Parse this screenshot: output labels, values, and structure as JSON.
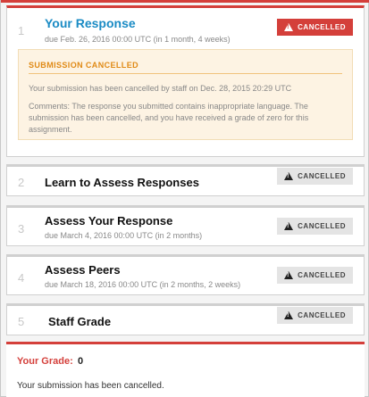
{
  "steps": [
    {
      "number": "1",
      "title": "Your Response",
      "due": "due Feb. 26, 2016 00:00 UTC (in 1 month, 4 weeks)",
      "status": "CANCELLED"
    },
    {
      "number": "2",
      "title": "Learn to Assess Responses",
      "due": "",
      "status": "CANCELLED"
    },
    {
      "number": "3",
      "title": "Assess Your Response",
      "due": "due March 4, 2016 00:00 UTC (in 2 months)",
      "status": "CANCELLED"
    },
    {
      "number": "4",
      "title": "Assess Peers",
      "due": "due March 18, 2016 00:00 UTC (in 2 months, 2 weeks)",
      "status": "CANCELLED"
    },
    {
      "number": "5",
      "title": "Staff Grade",
      "due": "",
      "status": "CANCELLED"
    }
  ],
  "notice": {
    "heading": "SUBMISSION CANCELLED",
    "line1": "Your submission has been cancelled by staff on Dec. 28, 2015 20:29 UTC",
    "line2": "Comments: The response you submitted contains inappropriate language. The submission has been cancelled, and you have received a grade of zero for this assignment."
  },
  "grade": {
    "label": "Your Grade:",
    "value": "0",
    "message": "Your submission has been cancelled."
  },
  "colors": {
    "accent_red": "#d43f3a",
    "link_blue": "#1a8bc4",
    "warning_orange": "#e08a16"
  },
  "icons": {
    "status_icon": "warning-triangle-icon"
  }
}
